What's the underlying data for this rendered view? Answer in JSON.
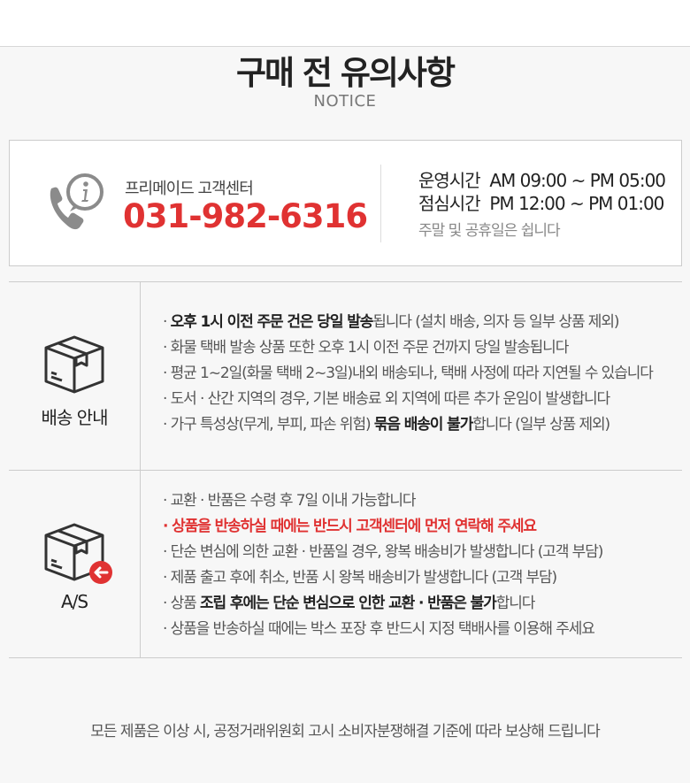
{
  "header": {
    "title": "구매 전 유의사항",
    "subtitle": "NOTICE"
  },
  "customer_center": {
    "icon": "phone-info-icon",
    "label": "프리메이드 고객센터",
    "phone": "031-982-6316",
    "hours": [
      "운영시간  AM 09:00 ~ PM 05:00",
      "점심시간  PM 12:00 ~ PM 01:00"
    ],
    "closed_note": "주말 및 공휴일은 쉽니다"
  },
  "sections": [
    {
      "icon": "delivery-box-icon",
      "label": "배송 안내",
      "items": [
        {
          "prefix": "· ",
          "bold": "오후 1시 이전 주문 건은 당일 발송",
          "rest": "됩니다 (설치 배송, 의자 등 일부 상품 제외)"
        },
        {
          "text": "· 화물 택배 발송 상품 또한 오후 1시 이전 주문 건까지 당일 발송됩니다"
        },
        {
          "text": "· 평균 1~2일(화물 택배 2~3일)내외 배송되나, 택배 사정에 따라 지연될 수 있습니다"
        },
        {
          "text": "· 도서 · 산간 지역의 경우, 기본 배송료 외 지역에 따른 추가 운임이 발생합니다"
        },
        {
          "prefix": "· 가구 특성상(무게, 부피, 파손 위험) ",
          "bold": "묶음 배송이 불가",
          "rest": "합니다 (일부 상품 제외)"
        }
      ]
    },
    {
      "icon": "return-box-icon",
      "label": "A/S",
      "items": [
        {
          "text": "· 교환 · 반품은 수령 후 7일 이내 가능합니다"
        },
        {
          "text": "· 상품을 반송하실 때에는 반드시 고객센터에 먼저 연락해 주세요",
          "highlight": "red"
        },
        {
          "text": "· 단순 변심에 의한 교환 · 반품일 경우, 왕복 배송비가 발생합니다 (고객 부담)"
        },
        {
          "text": "· 제품 출고 후에 취소, 반품 시 왕복 배송비가 발생합니다  (고객 부담)"
        },
        {
          "prefix": "· 상품 ",
          "bold": "조립 후에는 단순 변심으로 인한 교환 · 반품은 불가",
          "rest": "합니다"
        },
        {
          "text": "· 상품을 반송하실 때에는 박스 포장 후 반드시 지정 택배사를 이용해 주세요"
        }
      ]
    }
  ],
  "footer": "모든 제품은 이상 시, 공정거래위원회 고시 소비자분쟁해결 기준에 따라 보상해 드립니다",
  "colors": {
    "accent_red": "#e03232",
    "background": "#f7f7f7",
    "border": "#cccccc"
  }
}
